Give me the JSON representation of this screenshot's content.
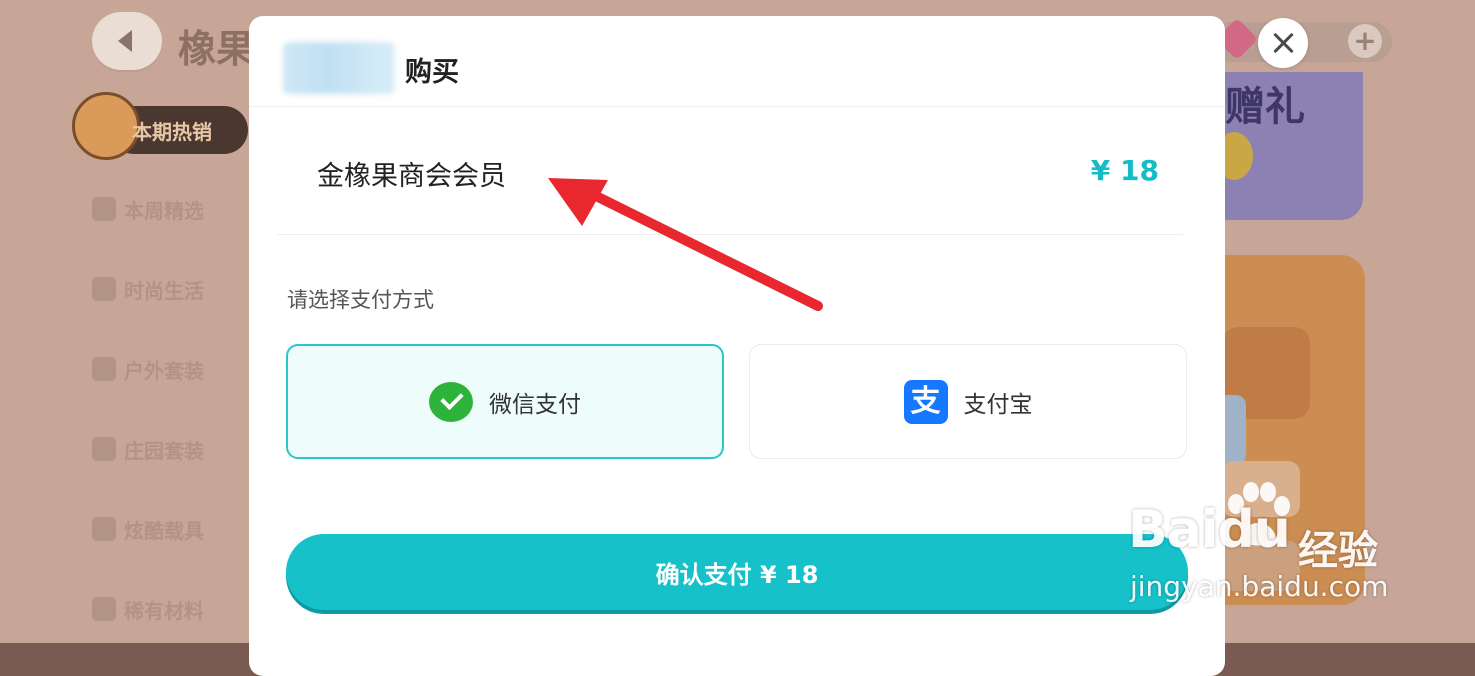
{
  "background": {
    "title": "橡果",
    "sidebar": {
      "active": "本期热销",
      "items": [
        "本周精选",
        "时尚生活",
        "户外套装",
        "庄园套装",
        "炫酷载具",
        "稀有材料"
      ]
    },
    "promo_text": "赠礼"
  },
  "modal": {
    "title": "购买",
    "product_name": "金橡果商会会员",
    "product_price": "¥ 18",
    "pay_prompt": "请选择支付方式",
    "payment_options": [
      {
        "label": "微信支付",
        "icon": "wechat-pay-icon",
        "selected": true
      },
      {
        "label": "支付宝",
        "icon": "alipay-icon",
        "selected": false
      }
    ],
    "confirm_label": "确认支付 ¥ 18"
  },
  "watermark": {
    "brand": "Baidu",
    "brand_cn": "经验",
    "url": "jingyan.baidu.com"
  },
  "colors": {
    "accent": "#16c1ca",
    "price": "#15bcc6",
    "annotation_arrow": "#e8272f"
  }
}
